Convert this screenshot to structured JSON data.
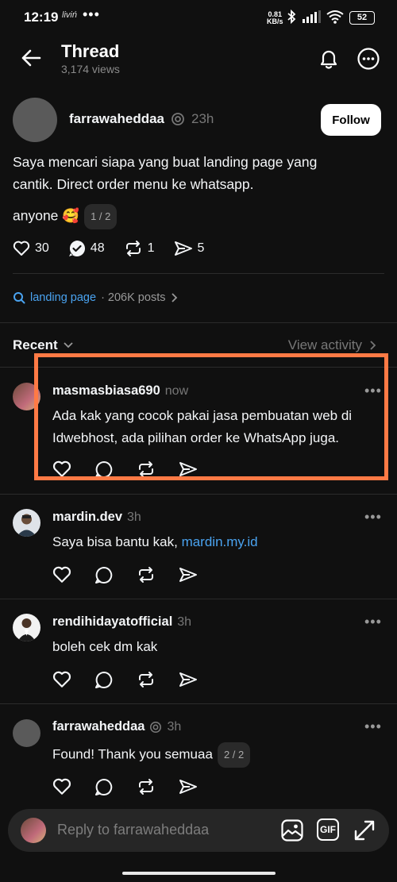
{
  "status": {
    "time": "12:19",
    "carrier_note": "liviń",
    "dots": "•••",
    "speed_value": "0.81",
    "speed_unit": "KB/s",
    "battery": "52"
  },
  "header": {
    "title": "Thread",
    "views": "3,174 views"
  },
  "post": {
    "username": "farrawaheddaa",
    "time": "23h",
    "follow_label": "Follow",
    "text_line1": "Saya mencari siapa yang buat landing page yang",
    "text_line2": "cantik. Direct order menu ke whatsapp.",
    "text_line3": "anyone 🥰",
    "pager": "1 / 2",
    "likes": "30",
    "replies": "48",
    "reposts": "1",
    "shares": "5"
  },
  "topic": {
    "link": "landing page",
    "posts": "· 206K posts"
  },
  "filter": {
    "sort": "Recent",
    "view_activity": "View activity"
  },
  "comments": [
    {
      "username": "masmasbiasa690",
      "time": "now",
      "line1": "Ada kak yang cocok pakai jasa pembuatan web di",
      "line2": "Idwebhost, ada pilihan order ke WhatsApp juga."
    },
    {
      "username": "mardin.dev",
      "time": "3h",
      "text": "Saya bisa bantu kak,",
      "link": "mardin.my.id"
    },
    {
      "username": "rendihidayatofficial",
      "time": "3h",
      "text": "boleh cek dm kak"
    },
    {
      "username": "farrawaheddaa",
      "time": "3h",
      "text": "Found! Thank you semuaa",
      "pager": "2 / 2"
    }
  ],
  "more_label": "•••",
  "reply": {
    "placeholder": "Reply to farrawaheddaa",
    "gif_label": "GIF"
  },
  "colors": {
    "background": "#101010",
    "link": "#4aa3f0",
    "highlight": "#ff7a45"
  }
}
